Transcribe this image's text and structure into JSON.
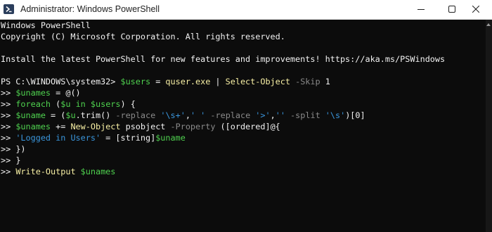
{
  "window": {
    "title": "Administrator: Windows PowerShell",
    "app_icon": "powershell-icon",
    "controls": [
      "minimize-icon",
      "maximize-icon",
      "close-icon"
    ]
  },
  "console": {
    "header": [
      "Windows PowerShell",
      "Copyright (C) Microsoft Corporation. All rights reserved.",
      "",
      "Install the latest PowerShell for new features and improvements! https://aka.ms/PSWindows",
      ""
    ],
    "prompt": "PS C:\\WINDOWS\\system32> ",
    "continuation": ">> ",
    "commands": [
      {
        "tokens": [
          {
            "t": "$users",
            "c": "var"
          },
          {
            "t": " = ",
            "c": "white"
          },
          {
            "t": "quser.exe",
            "c": "cmd"
          },
          {
            "t": " | ",
            "c": "white"
          },
          {
            "t": "Select-Object",
            "c": "cmd"
          },
          {
            "t": " -Skip",
            "c": "param"
          },
          {
            "t": " 1",
            "c": "white"
          }
        ]
      },
      {
        "tokens": [
          {
            "t": "$unames",
            "c": "var"
          },
          {
            "t": " = @()",
            "c": "white"
          }
        ]
      },
      {
        "tokens": [
          {
            "t": "foreach",
            "c": "var"
          },
          {
            "t": " (",
            "c": "white"
          },
          {
            "t": "$u",
            "c": "var"
          },
          {
            "t": " in ",
            "c": "var"
          },
          {
            "t": "$users",
            "c": "var"
          },
          {
            "t": ") {",
            "c": "white"
          }
        ]
      },
      {
        "tokens": [
          {
            "t": "$uname",
            "c": "var"
          },
          {
            "t": " = (",
            "c": "white"
          },
          {
            "t": "$u",
            "c": "var"
          },
          {
            "t": ".trim() ",
            "c": "white"
          },
          {
            "t": "-replace",
            "c": "param"
          },
          {
            "t": " '\\s+'",
            "c": "str"
          },
          {
            "t": ",",
            "c": "white"
          },
          {
            "t": "' '",
            "c": "str"
          },
          {
            "t": " -replace",
            "c": "param"
          },
          {
            "t": " '>'",
            "c": "str"
          },
          {
            "t": ",",
            "c": "white"
          },
          {
            "t": "''",
            "c": "str"
          },
          {
            "t": " -split",
            "c": "param"
          },
          {
            "t": " '\\s'",
            "c": "str"
          },
          {
            "t": ")[0]",
            "c": "white"
          }
        ]
      },
      {
        "tokens": [
          {
            "t": "$unames",
            "c": "var"
          },
          {
            "t": " += ",
            "c": "white"
          },
          {
            "t": "New-Object",
            "c": "cmd"
          },
          {
            "t": " psobject ",
            "c": "white"
          },
          {
            "t": "-Property",
            "c": "param"
          },
          {
            "t": " ([ordered]@{",
            "c": "white"
          }
        ]
      },
      {
        "tokens": [
          {
            "t": "'Logged in Users'",
            "c": "str"
          },
          {
            "t": " = [string]",
            "c": "white"
          },
          {
            "t": "$uname",
            "c": "var"
          }
        ]
      },
      {
        "tokens": [
          {
            "t": "})",
            "c": "white"
          }
        ]
      },
      {
        "tokens": [
          {
            "t": "}",
            "c": "white"
          }
        ]
      },
      {
        "tokens": [
          {
            "t": "Write-Output",
            "c": "cmd"
          },
          {
            "t": " ",
            "c": "white"
          },
          {
            "t": "$unames",
            "c": "var"
          }
        ]
      }
    ]
  },
  "colors": {
    "background": "#0c0c0c",
    "text": "#cccccc",
    "variable": "#4fd24f",
    "command": "#f9f1a5",
    "parameter": "#8a8a8a",
    "string": "#3a96dd",
    "titlebar": "#ffffff"
  }
}
